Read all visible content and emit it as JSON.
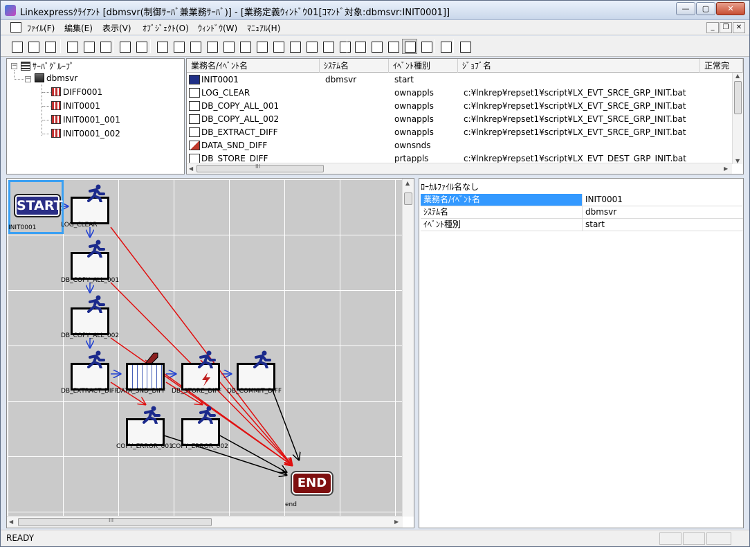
{
  "window": {
    "title": "Linkexpressｸﾗｲｱﾝﾄ [dbmsvr(制御ｻｰﾊﾞ兼業務ｻｰﾊﾞ)] - [業務定義ｳｨﾝﾄﾞｳ01[ｺﾏﾝﾄﾞ対象:dbmsvr:INIT0001]]",
    "min": "—",
    "max": "▢",
    "close": "✕"
  },
  "menu": {
    "items": [
      "ﾌｧｲﾙ(F)",
      "編集(E)",
      "表示(V)",
      "ｵﾌﾞｼﾞｪｸﾄ(O)",
      "ｳｨﾝﾄﾞｳ(W)",
      "ﾏﾆｭｱﾙ(H)"
    ],
    "mdi_min": "_",
    "mdi_restore": "❐",
    "mdi_close": "✕"
  },
  "toolbar": {
    "icons": [
      "new-window-icon",
      "open-icon",
      "properties-icon",
      "capture-icon",
      "folder-open-icon",
      "save-icon",
      "print-preview-icon",
      "print-icon",
      "app-event-icon",
      "app-event2-icon",
      "send-icon",
      "receive-icon",
      "file-send-icon",
      "file-receive-icon",
      "app-icon",
      "job-icon",
      "transfer-icon",
      "code-icon",
      "code2-icon",
      "delete-icon",
      "link-icon",
      "link2-icon",
      "link3-icon",
      "select-link-icon",
      "select-link2-icon",
      "switch-icon",
      "book-icon"
    ]
  },
  "tree": {
    "root": "ｻｰﾊﾞｸﾞﾙｰﾌﾟ",
    "server": "dbmsvr",
    "jobs": [
      "DIFF0001",
      "INIT0001",
      "INIT0001_001",
      "INIT0001_002"
    ]
  },
  "list": {
    "headers": [
      "業務名/ｲﾍﾞﾝﾄ名",
      "ｼｽﾃﾑ名",
      "ｲﾍﾞﾝﾄ種別",
      "ｼﾞｮﾌﾞ名",
      "正常完"
    ],
    "rows": [
      {
        "name": "INIT0001",
        "system": "dbmsvr",
        "type": "start",
        "job": "",
        "icon": "start"
      },
      {
        "name": "LOG_CLEAR",
        "system": "",
        "type": "ownappls",
        "job": "c:¥lnkrep¥repset1¥script¥LX_EVT_SRCE_GRP_INIT.bat",
        "icon": "app"
      },
      {
        "name": "DB_COPY_ALL_001",
        "system": "",
        "type": "ownappls",
        "job": "c:¥lnkrep¥repset1¥script¥LX_EVT_SRCE_GRP_INIT.bat",
        "icon": "app"
      },
      {
        "name": "DB_COPY_ALL_002",
        "system": "",
        "type": "ownappls",
        "job": "c:¥lnkrep¥repset1¥script¥LX_EVT_SRCE_GRP_INIT.bat",
        "icon": "app"
      },
      {
        "name": "DB_EXTRACT_DIFF",
        "system": "",
        "type": "ownappls",
        "job": "c:¥lnkrep¥repset1¥script¥LX_EVT_SRCE_GRP_INIT.bat",
        "icon": "app"
      },
      {
        "name": "DATA_SND_DIFF",
        "system": "",
        "type": "ownsnds",
        "job": "",
        "icon": "snd"
      },
      {
        "name": "DB_STORE_DIFF",
        "system": "",
        "type": "prtappls",
        "job": "c:¥lnkrep¥repset1¥script¥LX_EVT_DEST_GRP_INIT.bat",
        "icon": "app"
      }
    ],
    "up": "▲",
    "down": "▼",
    "left": "◀",
    "right": "▶",
    "grip": "III"
  },
  "canvas": {
    "start_label": "START",
    "start_caption": "INIT0001",
    "end_label": "END",
    "end_caption": "end",
    "nodes": [
      {
        "label": "LOG_CLEAR",
        "kind": "app"
      },
      {
        "label": "DB_COPY_ALL_001",
        "kind": "app"
      },
      {
        "label": "DB_COPY_ALL_002",
        "kind": "app"
      },
      {
        "label": "DB_EXTRACT_DIFF",
        "kind": "app"
      },
      {
        "label": "DATA_SND_DIFF",
        "kind": "snd"
      },
      {
        "label": "DB_STORE_DIFF",
        "kind": "app"
      },
      {
        "label": "DB_COMMIT_DIFF",
        "kind": "app"
      },
      {
        "label": "COPY_ERROR_001",
        "kind": "app"
      },
      {
        "label": "COPY_ERROR_002",
        "kind": "app"
      }
    ],
    "colors": {
      "normal": "#1f3fd0",
      "error": "#e01010",
      "end": "#000000"
    },
    "up": "▲",
    "left": "◀",
    "right": "▶",
    "grip": "III"
  },
  "properties": {
    "caption": "ﾛｰｶﾙﾌｧｲﾙ名なし",
    "rows": [
      {
        "key": "業務名/ｲﾍﾞﾝﾄ名",
        "value": "INIT0001"
      },
      {
        "key": "ｼｽﾃﾑ名",
        "value": "dbmsvr"
      },
      {
        "key": "ｲﾍﾞﾝﾄ種別",
        "value": "start"
      }
    ]
  },
  "status": {
    "text": "READY"
  }
}
